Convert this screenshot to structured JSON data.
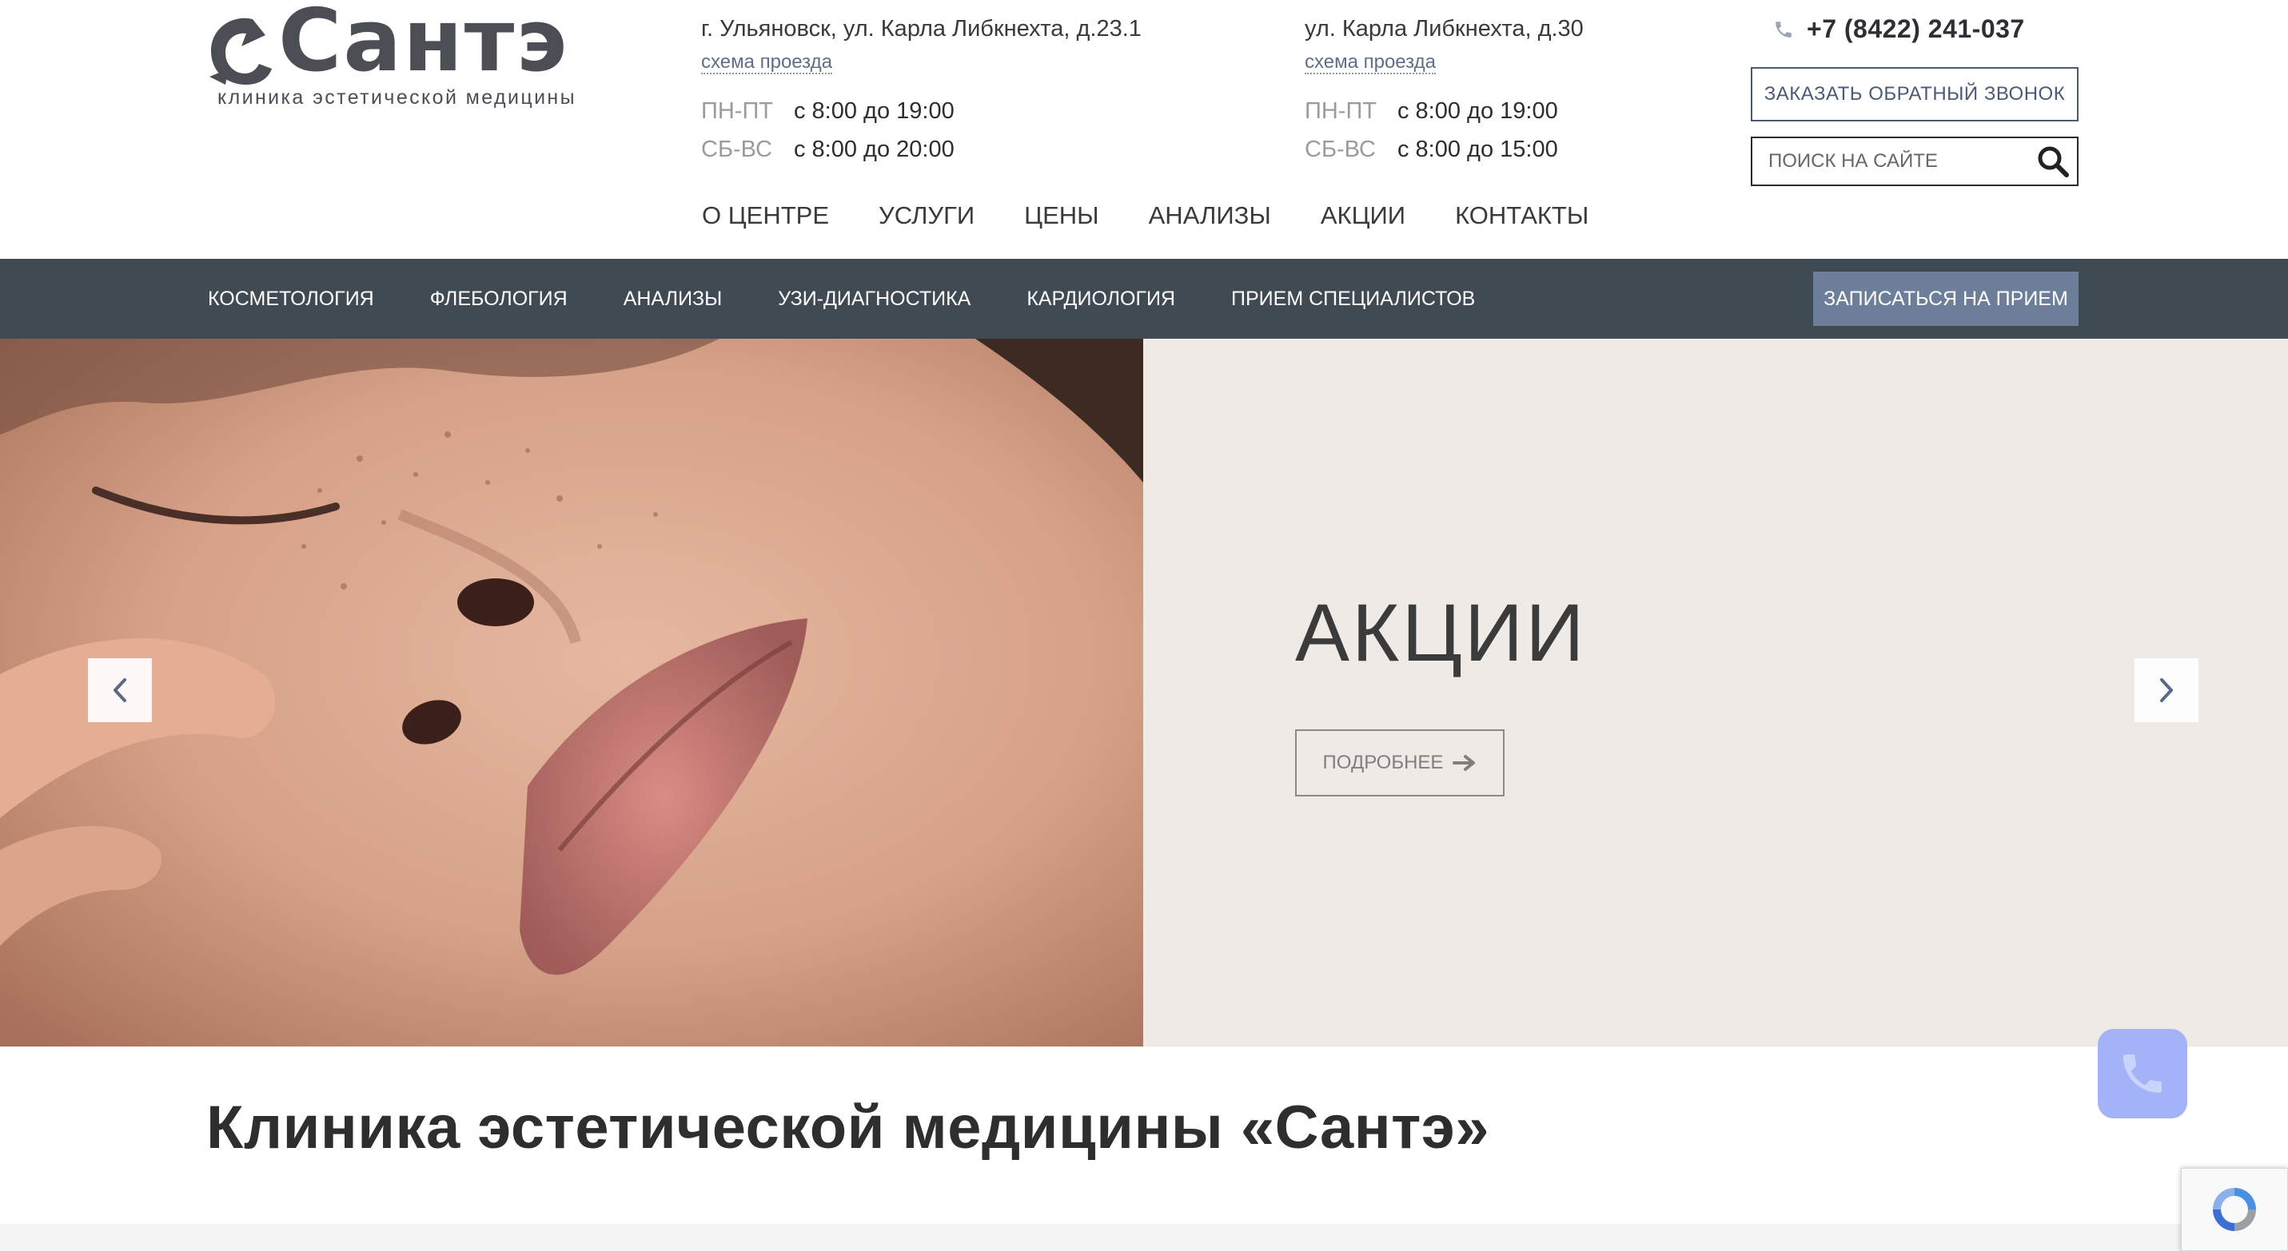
{
  "logo": {
    "name": "Сантэ",
    "tagline": "клиника эстетической медицины"
  },
  "addresses": [
    {
      "street": "г. Ульяновск, ул. Карла Либкнехта, д.23.1",
      "map_link": "схема проезда",
      "hours": [
        {
          "days": "ПН-ПТ",
          "time": "с 8:00 до 19:00"
        },
        {
          "days": "СБ-ВС",
          "time": "с 8:00 до 20:00"
        }
      ]
    },
    {
      "street": "ул. Карла Либкнехта, д.30",
      "map_link": "схема проезда",
      "hours": [
        {
          "days": "ПН-ПТ",
          "time": "с 8:00 до 19:00"
        },
        {
          "days": "СБ-ВС",
          "time": "с 8:00 до 15:00"
        }
      ]
    }
  ],
  "contact": {
    "phone": "+7 (8422) 241-037",
    "callback_label": "ЗАКАЗАТЬ ОБРАТНЫЙ ЗВОНОК",
    "search_placeholder": "ПОИСК НА САЙТЕ"
  },
  "main_nav": [
    "О ЦЕНТРЕ",
    "УСЛУГИ",
    "ЦЕНЫ",
    "АНАЛИЗЫ",
    "АКЦИИ",
    "КОНТАКТЫ"
  ],
  "category_nav": [
    "КОСМЕТОЛОГИЯ",
    "ФЛЕБОЛОГИЯ",
    "АНАЛИЗЫ",
    "УЗИ-ДИАГНОСТИКА",
    "КАРДИОЛОГИЯ",
    "ПРИЕМ СПЕЦИАЛИСТОВ"
  ],
  "appointment_label": "ЗАПИСАТЬСЯ НА ПРИЕМ",
  "hero": {
    "title": "АКЦИИ",
    "button_label": "ПОДРОБНЕЕ"
  },
  "page_heading": "Клиника эстетической медицины «Сантэ»",
  "colors": {
    "nav_bar": "#404a52",
    "accent_button": "#6d7e9b",
    "hero_bg": "#efeae5",
    "call_widget": "#a4b3f7"
  },
  "icons": {
    "phone": "phone-icon",
    "search": "search-icon",
    "arrow_right": "arrow-right-icon",
    "chevron_left": "chevron-left-icon",
    "chevron_right": "chevron-right-icon",
    "call_widget": "phone-handset-icon",
    "recaptcha": "recaptcha-icon"
  }
}
